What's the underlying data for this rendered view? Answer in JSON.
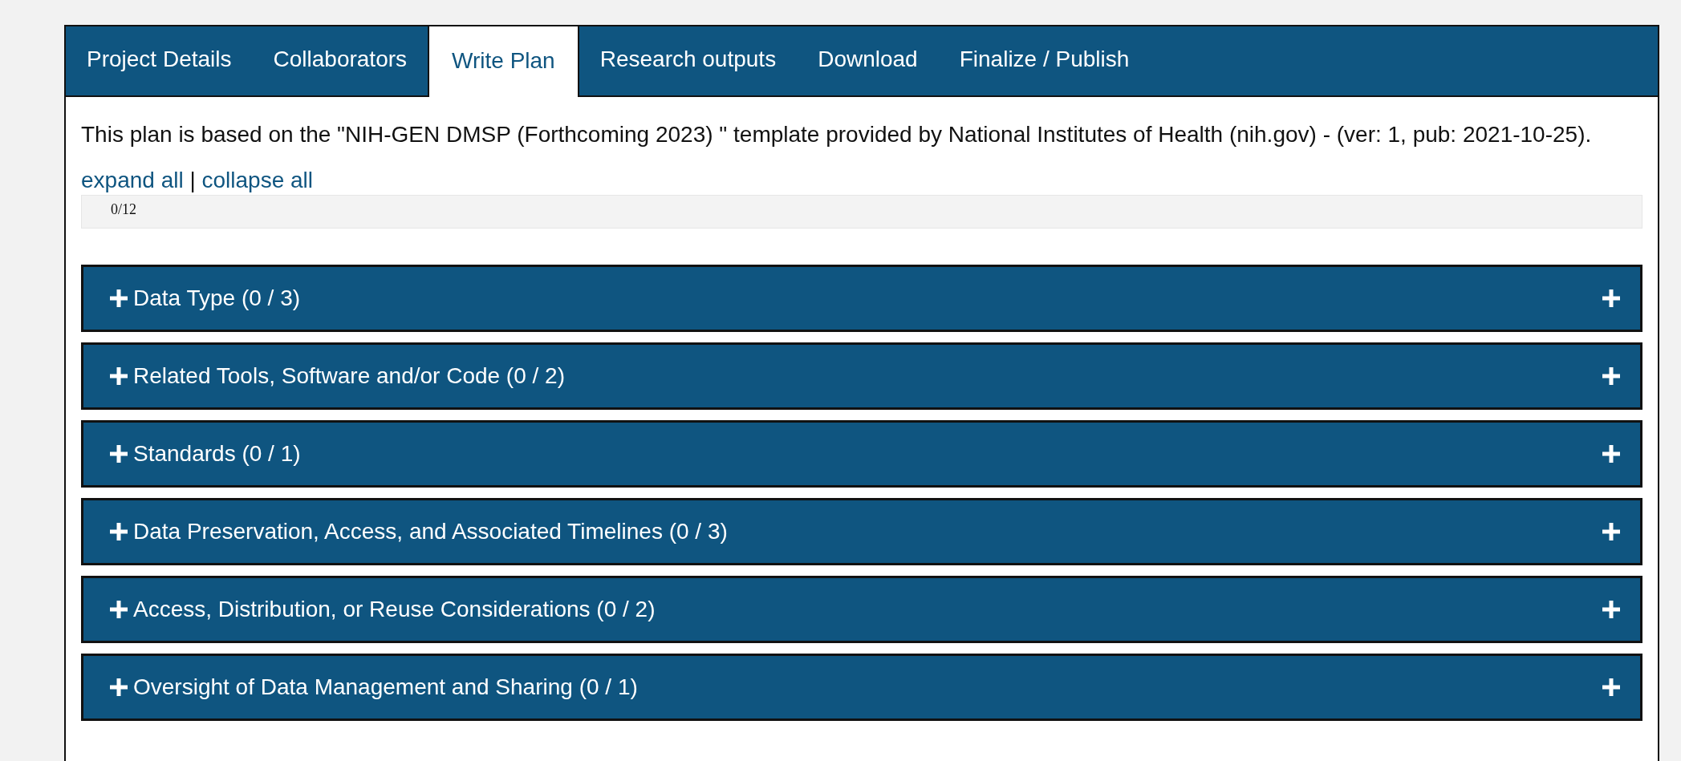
{
  "tabs": [
    {
      "label": "Project Details",
      "selected": false
    },
    {
      "label": "Collaborators",
      "selected": false
    },
    {
      "label": "Write Plan",
      "selected": true
    },
    {
      "label": "Research outputs",
      "selected": false
    },
    {
      "label": "Download",
      "selected": false
    },
    {
      "label": "Finalize / Publish",
      "selected": false
    }
  ],
  "intro": "This plan is based on the \"NIH-GEN DMSP (Forthcoming 2023) \" template provided by National Institutes of Health (nih.gov) - (ver: 1, pub: 2021-10-25).",
  "controls": {
    "expand": "expand all",
    "separator": "|",
    "collapse": "collapse all"
  },
  "progress": {
    "text": "0/12",
    "level": 0
  },
  "sections": [
    {
      "title": "Data Type (0 / 3)",
      "expanded": false
    },
    {
      "title": "Related Tools, Software and/or Code (0 / 2)",
      "expanded": false
    },
    {
      "title": "Standards (0 / 1)",
      "expanded": false
    },
    {
      "title": "Data Preservation, Access, and Associated Timelines (0 / 3)",
      "expanded": false
    },
    {
      "title": "Access, Distribution, or Reuse Considerations (0 / 2)",
      "expanded": false
    },
    {
      "title": "Oversight of Data Management and Sharing (0 / 1)",
      "expanded": false
    }
  ]
}
